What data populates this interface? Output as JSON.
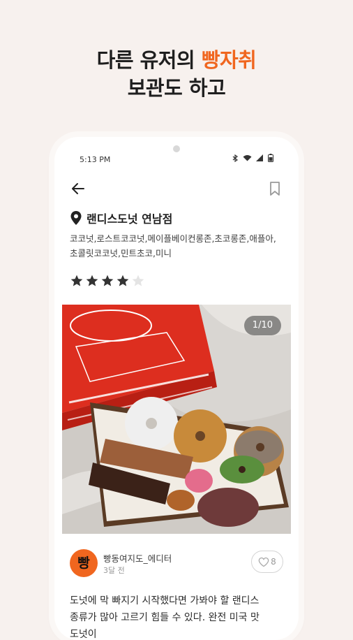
{
  "headline": {
    "line1_prefix": "다른 유저의 ",
    "line1_accent": "빵자취",
    "line2": "보관도 하고"
  },
  "colors": {
    "accent": "#f0661f",
    "background": "#f7f1ee"
  },
  "status_bar": {
    "time": "5:13 PM",
    "icons": [
      "bluetooth-icon",
      "wifi-icon",
      "signal-icon",
      "battery-icon"
    ]
  },
  "appbar": {
    "back_icon": "arrow-left-icon",
    "bookmark_icon": "bookmark-icon"
  },
  "place": {
    "icon": "map-pin-icon",
    "name": "랜디스도넛 연남점",
    "tags": "코코넛,로스트코코넛,메이플베이컨롱존,초코롱존,애플아,초콜릿코코넛,민트초코,미니"
  },
  "rating": {
    "value": 4,
    "max": 5
  },
  "photo": {
    "counter": "1/10"
  },
  "author": {
    "avatar_text": "빵",
    "name": "빵동여지도_에디터",
    "ago": "3달 전",
    "like_count": "8"
  },
  "review_text": "도넛에 막 빠지기 시작했다면 가봐야 할 랜디스 종류가 많아 고르기 힘들 수 있다. 완전 미국 맛 도넛이"
}
